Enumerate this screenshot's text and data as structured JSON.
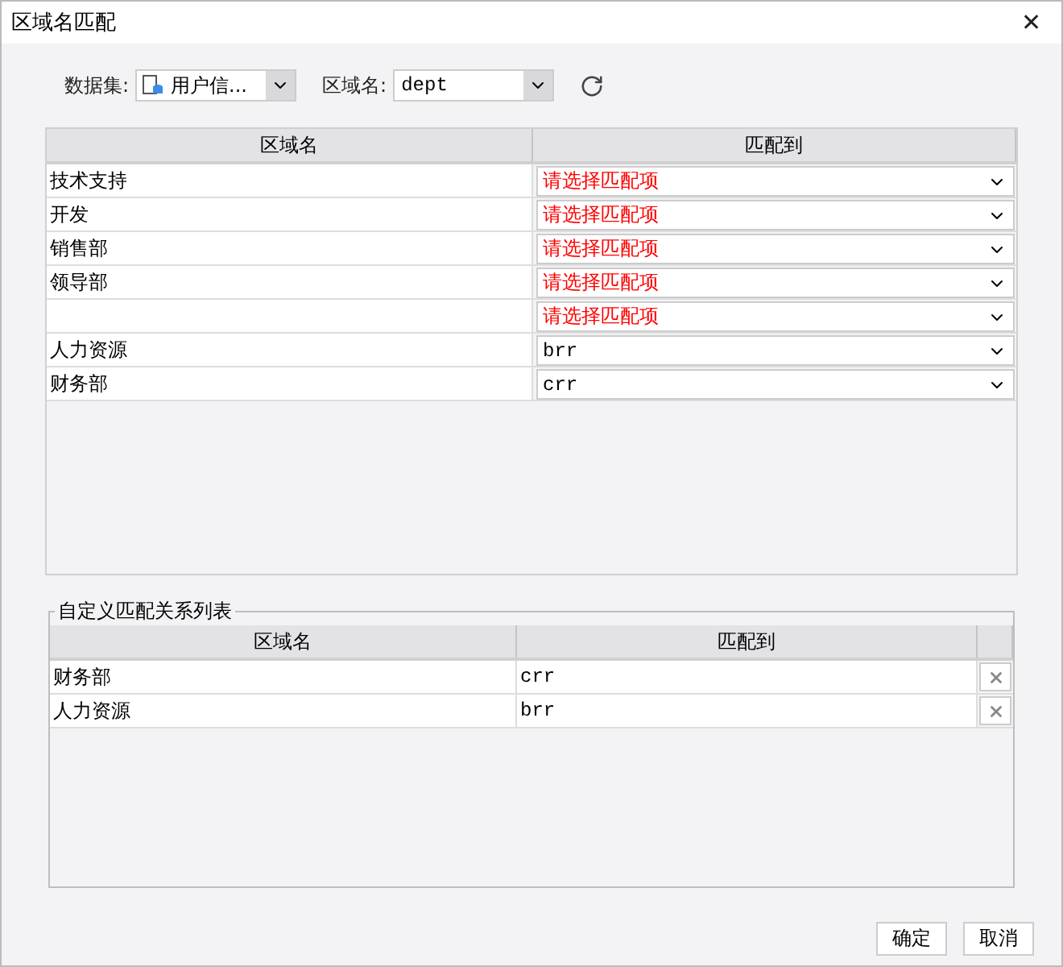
{
  "window": {
    "title": "区域名匹配",
    "close": "✕"
  },
  "toolbar": {
    "dataset_label": "数据集:",
    "dataset_value": "用户信...",
    "region_label": "区域名:",
    "region_value": "dept"
  },
  "match_table": {
    "columns": [
      "区域名",
      "匹配到"
    ],
    "rows": [
      {
        "name": "技术支持",
        "match": "请选择匹配项",
        "unset": true
      },
      {
        "name": "开发",
        "match": "请选择匹配项",
        "unset": true
      },
      {
        "name": "销售部",
        "match": "请选择匹配项",
        "unset": true
      },
      {
        "name": "领导部",
        "match": "请选择匹配项",
        "unset": true
      },
      {
        "name": "",
        "match": "请选择匹配项",
        "unset": true
      },
      {
        "name": "人力资源",
        "match": "brr",
        "unset": false
      },
      {
        "name": "财务部",
        "match": "crr",
        "unset": false
      }
    ]
  },
  "custom_list": {
    "title": "自定义匹配关系列表",
    "columns": [
      "区域名",
      "匹配到"
    ],
    "rows": [
      {
        "name": "财务部",
        "match": "crr"
      },
      {
        "name": "人力资源",
        "match": "brr"
      }
    ]
  },
  "buttons": [
    "确定",
    "取消"
  ]
}
